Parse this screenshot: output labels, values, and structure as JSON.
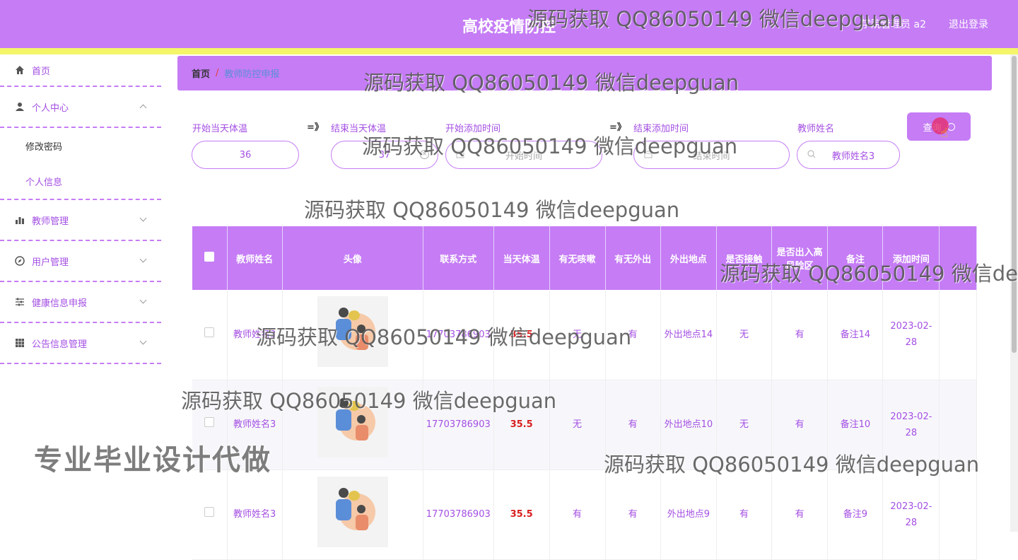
{
  "header": {
    "title": "高校疫情防控",
    "user": "学院管理员 a2",
    "logout": "退出登录"
  },
  "sidebar": {
    "home": "首页",
    "personal_center": "个人中心",
    "change_password": "修改密码",
    "personal_info": "个人信息",
    "teacher_mgmt": "教师管理",
    "user_mgmt": "用户管理",
    "health_report": "健康信息申报",
    "notice_mgmt": "公告信息管理"
  },
  "breadcrumb": {
    "home": "首页",
    "separator": "/",
    "current": "教师防控申报"
  },
  "filters": {
    "start_temp_label": "开始当天体温",
    "start_temp_value": "36",
    "arrow1": "=》",
    "end_temp_label": "结束当天体温",
    "end_temp_value": "37",
    "start_time_label": "开始添加时间",
    "start_time_placeholder": "开始时间",
    "arrow2": "=》",
    "end_time_label": "结束添加时间",
    "end_time_placeholder": "结束时间",
    "teacher_name_label": "教师姓名",
    "teacher_name_value": "教师姓名3",
    "query_button": "查询"
  },
  "table": {
    "headers": [
      "教师姓名",
      "头像",
      "联系方式",
      "当天体温",
      "有无咳嗽",
      "有无外出",
      "外出地点",
      "是否接触",
      "是否出入高风险区",
      "备注",
      "添加时间"
    ],
    "rows": [
      {
        "name": "教师姓名3",
        "phone": "17703786903",
        "temp": "35.5",
        "cough": "无",
        "out": "有",
        "place": "外出地点14",
        "contact": "无",
        "risk": "有",
        "note": "备注14",
        "time": "2023-02-28"
      },
      {
        "name": "教师姓名3",
        "phone": "17703786903",
        "temp": "35.5",
        "cough": "无",
        "out": "有",
        "place": "外出地点10",
        "contact": "无",
        "risk": "有",
        "note": "备注10",
        "time": "2023-02-28"
      },
      {
        "name": "教师姓名3",
        "phone": "17703786903",
        "temp": "35.5",
        "cough": "有",
        "out": "有",
        "place": "外出地点9",
        "contact": "有",
        "risk": "有",
        "note": "备注9",
        "time": "2023-02-28"
      }
    ]
  },
  "watermarks": {
    "text": "源码获取 QQ86050149 微信deepguan",
    "side": "专业毕业设计代做"
  }
}
